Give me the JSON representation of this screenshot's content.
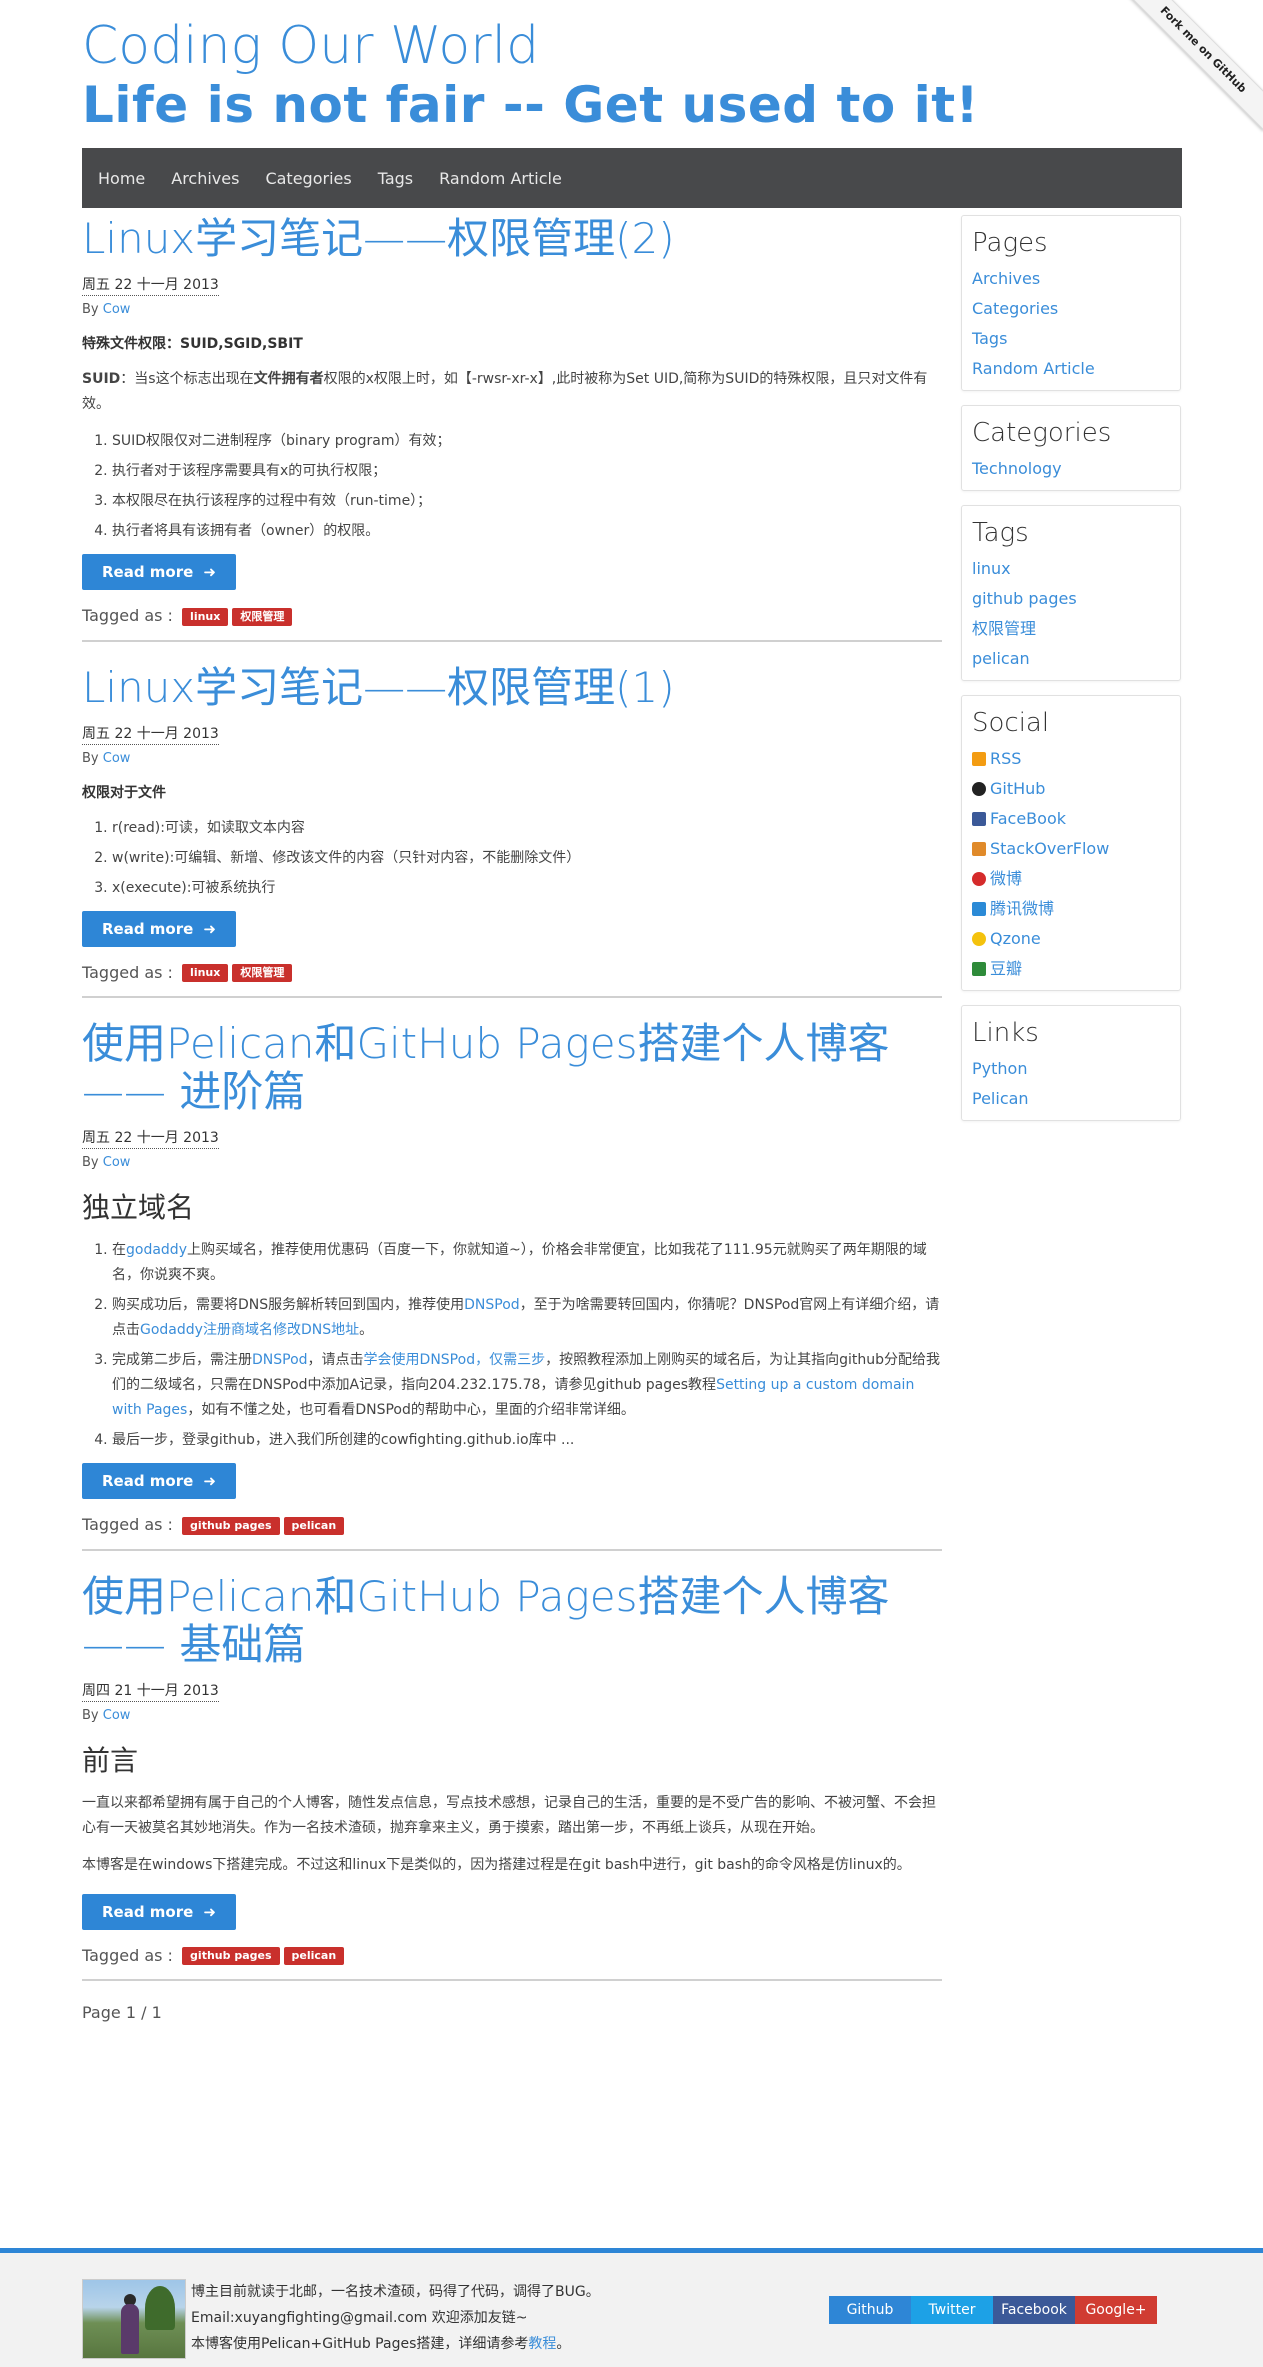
{
  "header": {
    "title": "Coding Our World",
    "subtitle": "Life is not fair -- Get used to it!",
    "ribbon": "Fork me on GitHub"
  },
  "nav": [
    "Home",
    "Archives",
    "Categories",
    "Tags",
    "Random Article"
  ],
  "posts": [
    {
      "title": "Linux学习笔记——权限管理(2)",
      "date": "周五 22 十一月 2013",
      "by": "By",
      "author": "Cow",
      "subhead": "特殊文件权限：SUID,SGID,SBIT",
      "para_label": "SUID",
      "para_a": "：当s这个标志出现在",
      "para_bold": "文件拥有者",
      "para_b": "权限的x权限上时，如【-rwsr-xr-x】,此时被称为Set UID,简称为SUID的特殊权限，且只对文件有效。",
      "list": [
        "SUID权限仅对二进制程序（binary program）有效；",
        "执行者对于该程序需要具有x的可执行权限；",
        "本权限尽在执行该程序的过程中有效（run-time）；",
        "执行者将具有该拥有者（owner）的权限。"
      ],
      "readmore": "Read more",
      "tagged": "Tagged as :",
      "tags": [
        "linux",
        "权限管理"
      ]
    },
    {
      "title": "Linux学习笔记——权限管理(1)",
      "date": "周五 22 十一月 2013",
      "by": "By",
      "author": "Cow",
      "subhead": "权限对于文件",
      "list": [
        "r(read):可读，如读取文本内容",
        "w(write):可编辑、新增、修改该文件的内容（只针对内容，不能删除文件）",
        "x(execute):可被系统执行"
      ],
      "readmore": "Read more",
      "tagged": "Tagged as :",
      "tags": [
        "linux",
        "权限管理"
      ]
    },
    {
      "title_line1": "使用Pelican和GitHub Pages搭建个人博客",
      "title_line2": "—— 进阶篇",
      "date": "周五 22 十一月 2013",
      "by": "By",
      "author": "Cow",
      "heading": "独立域名",
      "li1_a": "在",
      "li1_link": "godaddy",
      "li1_b": "上购买域名，推荐使用优惠码（百度一下，你就知道~），价格会非常便宜，比如我花了111.95元就购买了两年期限的域名，你说爽不爽。",
      "li2_a": "购买成功后，需要将DNS服务解析转回到国内，推荐使用",
      "li2_link1": "DNSPod",
      "li2_b": "，至于为啥需要转回国内，你猜呢？DNSPod官网上有详细介绍，请点击",
      "li2_link2": "Godaddy注册商域名修改DNS地址",
      "li2_c": "。",
      "li3_a": "完成第二步后，需注册",
      "li3_link1": "DNSPod",
      "li3_b": "，请点击",
      "li3_link2": "学会使用DNSPod，仅需三步",
      "li3_c": "，按照教程添加上刚购买的域名后，为让其指向github分配给我们的二级域名，只需在DNSPod中添加A记录，指向204.232.175.78，请参见github pages教程",
      "li3_link3": "Setting up a custom domain with Pages",
      "li3_d": "，如有不懂之处，也可看看DNSPod的帮助中心，里面的介绍非常详细。",
      "li4": "最后一步，登录github，进入我们所创建的cowfighting.github.io库中 ...",
      "readmore": "Read more",
      "tagged": "Tagged as :",
      "tags": [
        "github pages",
        "pelican"
      ]
    },
    {
      "title_line1": "使用Pelican和GitHub Pages搭建个人博客",
      "title_line2": "—— 基础篇",
      "date": "周四 21 十一月 2013",
      "by": "By",
      "author": "Cow",
      "heading": "前言",
      "p1": "一直以来都希望拥有属于自己的个人博客，随性发点信息，写点技术感想，记录自己的生活，重要的是不受广告的影响、不被河蟹、不会担心有一天被莫名其妙地消失。作为一名技术渣硕，抛弃拿来主义，勇于摸索，踏出第一步，不再纸上谈兵，从现在开始。",
      "p2": "本博客是在windows下搭建完成。不过这和linux下是类似的，因为搭建过程是在git bash中进行，git bash的命令风格是仿linux的。",
      "readmore": "Read more",
      "tagged": "Tagged as :",
      "tags": [
        "github pages",
        "pelican"
      ]
    }
  ],
  "pager": "Page 1 / 1",
  "sidebar": {
    "pages": {
      "title": "Pages",
      "items": [
        "Archives",
        "Categories",
        "Tags",
        "Random Article"
      ]
    },
    "categories": {
      "title": "Categories",
      "items": [
        "Technology"
      ]
    },
    "tags": {
      "title": "Tags",
      "items": [
        "linux",
        "github pages",
        "权限管理",
        "pelican"
      ]
    },
    "social": {
      "title": "Social",
      "items": [
        {
          "label": "RSS",
          "icon": "rss-icon",
          "color": "#f39c12"
        },
        {
          "label": "GitHub",
          "icon": "github-icon",
          "color": "#222222"
        },
        {
          "label": "FaceBook",
          "icon": "facebook-icon",
          "color": "#3b5998"
        },
        {
          "label": "StackOverFlow",
          "icon": "stackoverflow-icon",
          "color": "#e08a2a"
        },
        {
          "label": "微博",
          "icon": "weibo-icon",
          "color": "#d52b2b"
        },
        {
          "label": "腾讯微博",
          "icon": "tencent-weibo-icon",
          "color": "#2b8ad6"
        },
        {
          "label": "Qzone",
          "icon": "qzone-icon",
          "color": "#f4c20d"
        },
        {
          "label": "豆瓣",
          "icon": "douban-icon",
          "color": "#2e8b3a"
        }
      ]
    },
    "links": {
      "title": "Links",
      "items": [
        "Python",
        "Pelican"
      ]
    }
  },
  "footer": {
    "line1": "博主目前就读于北邮，一名技术渣硕，码得了代码，调得了BUG。",
    "line2": "Email:xuyangfighting@gmail.com 欢迎添加友链~",
    "line3_a": "本博客使用Pelican+GitHub Pages搭建，详细请参考",
    "line3_link": "教程",
    "line3_b": "。",
    "buttons": [
      {
        "label": "Github",
        "color": "#2e86d6"
      },
      {
        "label": "Twitter",
        "color": "#1da1e6"
      },
      {
        "label": "Facebook",
        "color": "#3b5998"
      },
      {
        "label": "Google+",
        "color": "#d03c32"
      }
    ]
  }
}
